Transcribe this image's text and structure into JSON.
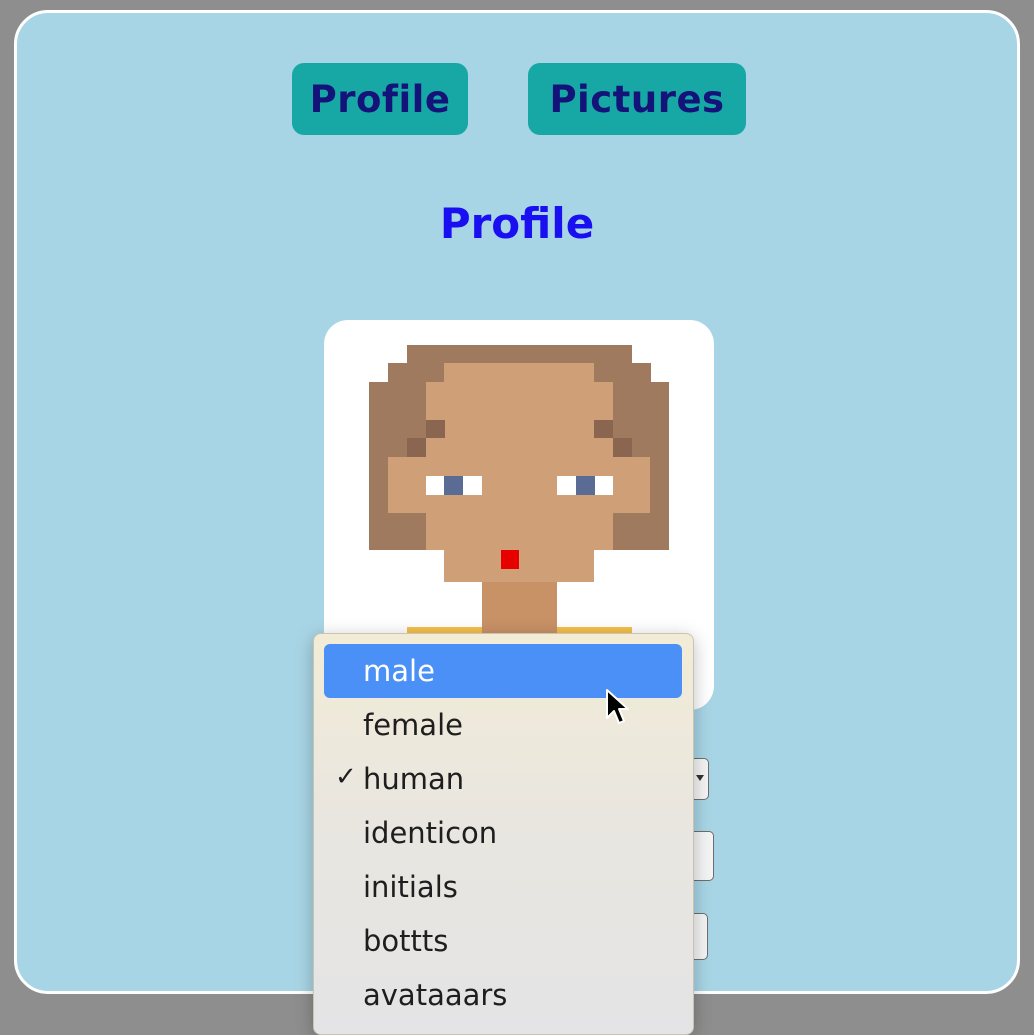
{
  "nav": {
    "profile_label": "Profile",
    "pictures_label": "Pictures"
  },
  "page": {
    "title": "Profile"
  },
  "avatar": {
    "style": "human",
    "colors": {
      "skin": "#cf9f77",
      "hair": "#a07a5e",
      "hair_dark": "#8a6550",
      "eye_white": "#ffffff",
      "iris": "#5a6b94",
      "mouth": "#e60000",
      "neck": "#c99166",
      "shirt": "#f5c04a"
    }
  },
  "dropdown": {
    "items": [
      {
        "label": "male",
        "highlighted": true,
        "checked": false
      },
      {
        "label": "female",
        "highlighted": false,
        "checked": false
      },
      {
        "label": "human",
        "highlighted": false,
        "checked": true
      },
      {
        "label": "identicon",
        "highlighted": false,
        "checked": false
      },
      {
        "label": "initials",
        "highlighted": false,
        "checked": false
      },
      {
        "label": "bottts",
        "highlighted": false,
        "checked": false
      },
      {
        "label": "avataaars",
        "highlighted": false,
        "checked": false
      }
    ],
    "check_glyph": "✓"
  },
  "colors": {
    "background": "#a8d5e5",
    "nav_button": "#17a8a6",
    "nav_text": "#13137a",
    "title": "#1a0ff0",
    "highlight": "#4a90f7"
  }
}
